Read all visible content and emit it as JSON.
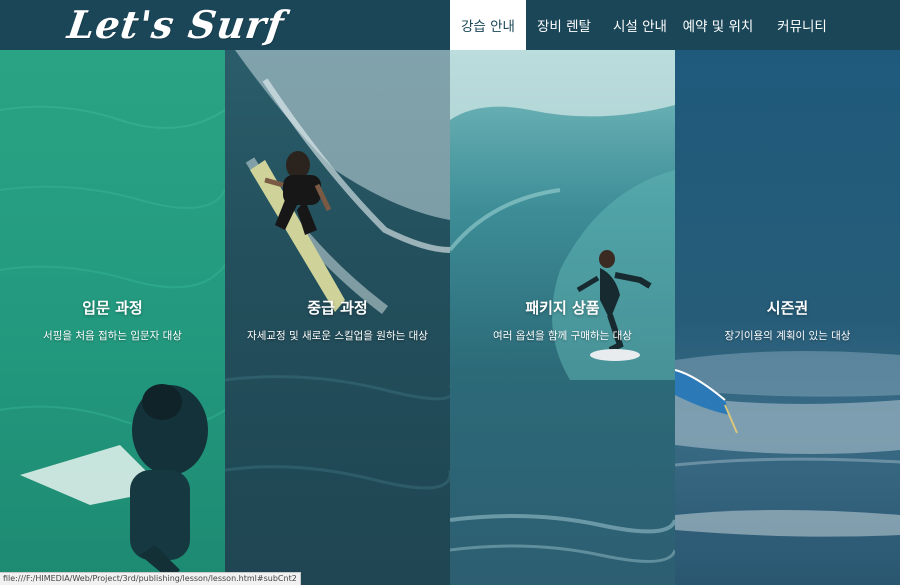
{
  "header": {
    "logo_text": "Let's Surf",
    "nav": [
      {
        "label": "강습 안내",
        "active": true
      },
      {
        "label": "장비 렌탈",
        "active": false
      },
      {
        "label": "시설 안내",
        "active": false
      },
      {
        "label": "예약 및 위치",
        "active": false
      },
      {
        "label": "커뮤니티",
        "active": false
      }
    ]
  },
  "panels": [
    {
      "title": "입문 과정",
      "desc": "서핑을 처음 접하는 입문자 대상"
    },
    {
      "title": "중급 과정",
      "desc": "자세교정 및 새로운 스킬업을 원하는 대상"
    },
    {
      "title": "패키지 상품",
      "desc": "여러 옵션을 함께 구매하는 대상"
    },
    {
      "title": "시즌권",
      "desc": "장기이용의 계획이 있는 대상"
    }
  ],
  "status_bar": {
    "url": "file:///F:/HIMEDIA/Web/Project/3rd/publishing/lesson/lesson.html#subCnt2"
  },
  "colors": {
    "header_bg": "#1a4658",
    "active_nav_bg": "#ffffff"
  }
}
